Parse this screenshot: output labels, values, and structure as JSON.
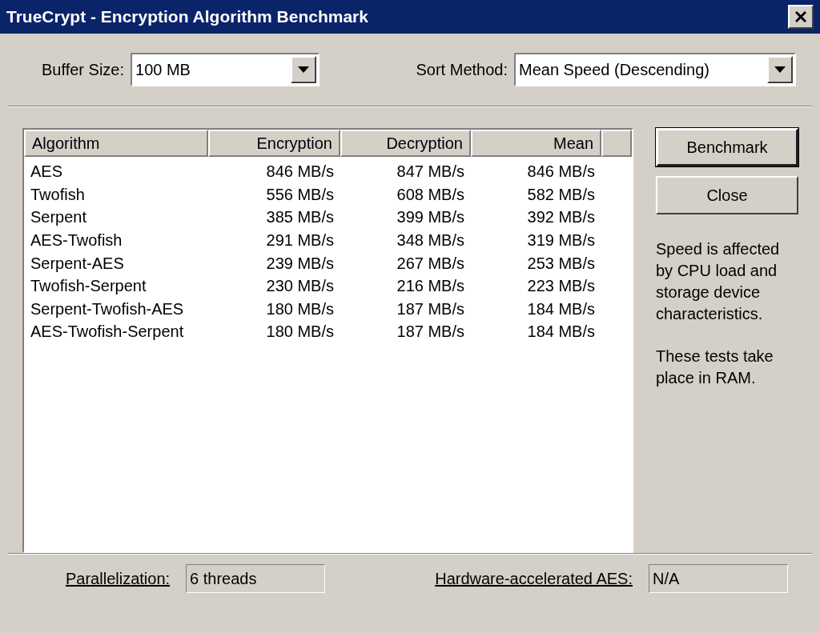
{
  "window": {
    "title": "TrueCrypt - Encryption Algorithm Benchmark"
  },
  "buffer_size": {
    "label": "Buffer Size:",
    "value": "100 MB"
  },
  "sort_method": {
    "label": "Sort Method:",
    "value": "Mean Speed (Descending)"
  },
  "table": {
    "columns": [
      "Algorithm",
      "Encryption",
      "Decryption",
      "Mean"
    ],
    "rows": [
      [
        "AES",
        "846 MB/s",
        "847 MB/s",
        "846 MB/s"
      ],
      [
        "Twofish",
        "556 MB/s",
        "608 MB/s",
        "582 MB/s"
      ],
      [
        "Serpent",
        "385 MB/s",
        "399 MB/s",
        "392 MB/s"
      ],
      [
        "AES-Twofish",
        "291 MB/s",
        "348 MB/s",
        "319 MB/s"
      ],
      [
        "Serpent-AES",
        "239 MB/s",
        "267 MB/s",
        "253 MB/s"
      ],
      [
        "Twofish-Serpent",
        "230 MB/s",
        "216 MB/s",
        "223 MB/s"
      ],
      [
        "Serpent-Twofish-AES",
        "180 MB/s",
        "187 MB/s",
        "184 MB/s"
      ],
      [
        "AES-Twofish-Serpent",
        "180 MB/s",
        "187 MB/s",
        "184 MB/s"
      ]
    ]
  },
  "buttons": [
    {
      "label": "Benchmark",
      "default": true
    },
    {
      "label": "Close",
      "default": false
    }
  ],
  "notes": [
    "Speed is affected by CPU load and storage device characteristics.",
    "These tests take place in RAM."
  ],
  "parallelization": {
    "label": "Parallelization:",
    "value": "6 threads"
  },
  "hardware_aes": {
    "label": "Hardware-accelerated AES:",
    "value": "N/A"
  }
}
